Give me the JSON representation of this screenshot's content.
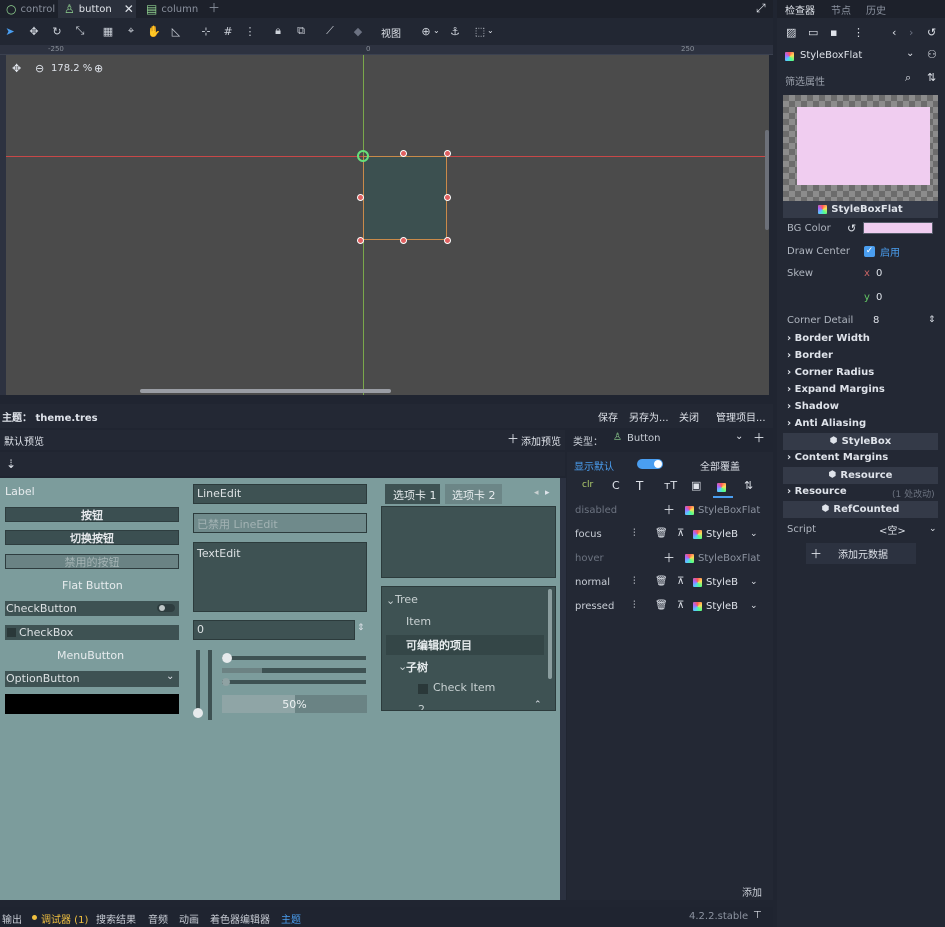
{
  "scene_tabs": [
    {
      "label": "control",
      "active": false
    },
    {
      "label": "button",
      "active": true
    },
    {
      "label": "column",
      "active": false
    }
  ],
  "toolbar": {
    "view_label": "视图"
  },
  "viewport": {
    "zoom": "178.2 %",
    "ruler_ticks": [
      "-250",
      "0",
      "250"
    ]
  },
  "theme_bar": {
    "title": "主题： theme.tres",
    "save": "保存",
    "save_as": "另存为...",
    "close": "关闭",
    "manage": "管理项目..."
  },
  "preview_bar": {
    "tab": "默认预览",
    "add_preview": "添加预览",
    "type_label": "类型：",
    "type_value": "Button"
  },
  "preview": {
    "label": "Label",
    "button": "按钮",
    "toggle_button": "切换按钮",
    "disabled_button": "禁用的按钮",
    "flat_button": "Flat Button",
    "check_button": "CheckButton",
    "check_box": "CheckBox",
    "menu_button": "MenuButton",
    "option_button": "OptionButton",
    "line_edit": "LineEdit",
    "line_edit_disabled": "已禁用 LineEdit",
    "text_edit": "TextEdit",
    "spin_value": "0",
    "progress": "50%",
    "tab1": "选项卡 1",
    "tab2": "选项卡 2",
    "tree_root": "Tree",
    "tree_item": "Item",
    "tree_editable": "可编辑的项目",
    "tree_subtree": "子树",
    "tree_check": "Check Item",
    "tree_more": "2"
  },
  "type_panel": {
    "show_default": "显示默认",
    "override_all": "全部覆盖",
    "rows": [
      {
        "state": "disabled",
        "value": "StyleBoxFlat",
        "style": "dim"
      },
      {
        "state": "focus",
        "value": "StyleB",
        "style": "set"
      },
      {
        "state": "hover",
        "value": "StyleBoxFlat",
        "style": "dim"
      },
      {
        "state": "normal",
        "value": "StyleB",
        "style": "set"
      },
      {
        "state": "pressed",
        "value": "StyleB",
        "style": "set"
      }
    ],
    "add": "添加"
  },
  "statusbar": {
    "output": "输出",
    "debugger": "调试器 (1)",
    "search": "搜索结果",
    "audio": "音频",
    "animation": "动画",
    "shader": "着色器编辑器",
    "theme": "主题",
    "version": "4.2.2.stable"
  },
  "dock": {
    "tabs": [
      "检查器",
      "节点",
      "历史"
    ],
    "resource_type": "StyleBoxFlat",
    "filter": "筛选属性",
    "preview_caption": "StyleBoxFlat",
    "bg_color_label": "BG Color",
    "bg_color": "#f0cdf0",
    "draw_center_label": "Draw Center",
    "draw_center_value": "启用",
    "skew_label": "Skew",
    "skew_x_label": "x",
    "skew_x": "0",
    "skew_y_label": "y",
    "skew_y": "0",
    "corner_detail_label": "Corner Detail",
    "corner_detail": "8",
    "sections": [
      "Border Width",
      "Border",
      "Corner Radius",
      "Expand Margins",
      "Shadow",
      "Anti Aliasing"
    ],
    "stylebox_header": "StyleBox",
    "content_margins": "Content Margins",
    "resource_header": "Resource",
    "resource_section": "Resource",
    "resource_note": "(1 处改动)",
    "refcounted_header": "RefCounted",
    "script_label": "Script",
    "script_value": "<空>",
    "add_metadata": "添加元数据"
  },
  "colors": {
    "accent": "#4a9ef0",
    "guide_red": "#c84848",
    "guide_green": "#7aa84b",
    "selection_box": "#3c5050"
  }
}
